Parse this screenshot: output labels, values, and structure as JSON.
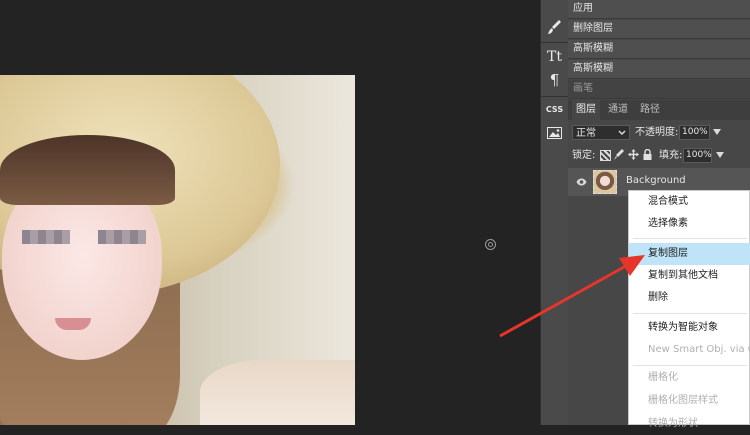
{
  "history": {
    "items": [
      {
        "label": "应用"
      },
      {
        "label": "删除图层"
      },
      {
        "label": "高斯模糊"
      },
      {
        "label": "高斯模糊"
      },
      {
        "label": "画笔"
      }
    ]
  },
  "toolbar": {
    "tools": [
      {
        "icon": "brush-tool-icon"
      },
      {
        "icon": "text-tool-icon",
        "glyph": "Tt"
      },
      {
        "icon": "paragraph-icon",
        "glyph": "¶"
      },
      {
        "icon": "css-icon",
        "glyph": "CSS"
      },
      {
        "icon": "image-icon"
      }
    ]
  },
  "layers_panel": {
    "tabs": [
      {
        "label": "图层",
        "active": true
      },
      {
        "label": "通道",
        "active": false
      },
      {
        "label": "路径",
        "active": false
      }
    ],
    "blend_mode": "正常",
    "opacity_label": "不透明度:",
    "opacity_value": "100%",
    "lock_label": "锁定:",
    "fill_label": "填充:",
    "fill_value": "100%",
    "layer": {
      "name": "Background"
    }
  },
  "context_menu": {
    "items": [
      {
        "label": "混合模式",
        "state": "normal"
      },
      {
        "label": "选择像素",
        "state": "normal"
      },
      {
        "label": "复制图层",
        "state": "highlighted"
      },
      {
        "label": "复制到其他文档",
        "state": "normal"
      },
      {
        "label": "删除",
        "state": "normal"
      },
      {
        "label": "转换为智能对象",
        "state": "normal"
      },
      {
        "label": "New Smart Obj. via Copy",
        "state": "disabled"
      },
      {
        "label": "栅格化",
        "state": "disabled"
      },
      {
        "label": "栅格化图层样式",
        "state": "disabled"
      },
      {
        "label": "转换为形状",
        "state": "disabled"
      }
    ]
  },
  "colors": {
    "canvas_bg": "#232323",
    "panel_bg": "#474747",
    "menu_highlight": "#bfe3f7",
    "arrow": "#e8352b"
  }
}
